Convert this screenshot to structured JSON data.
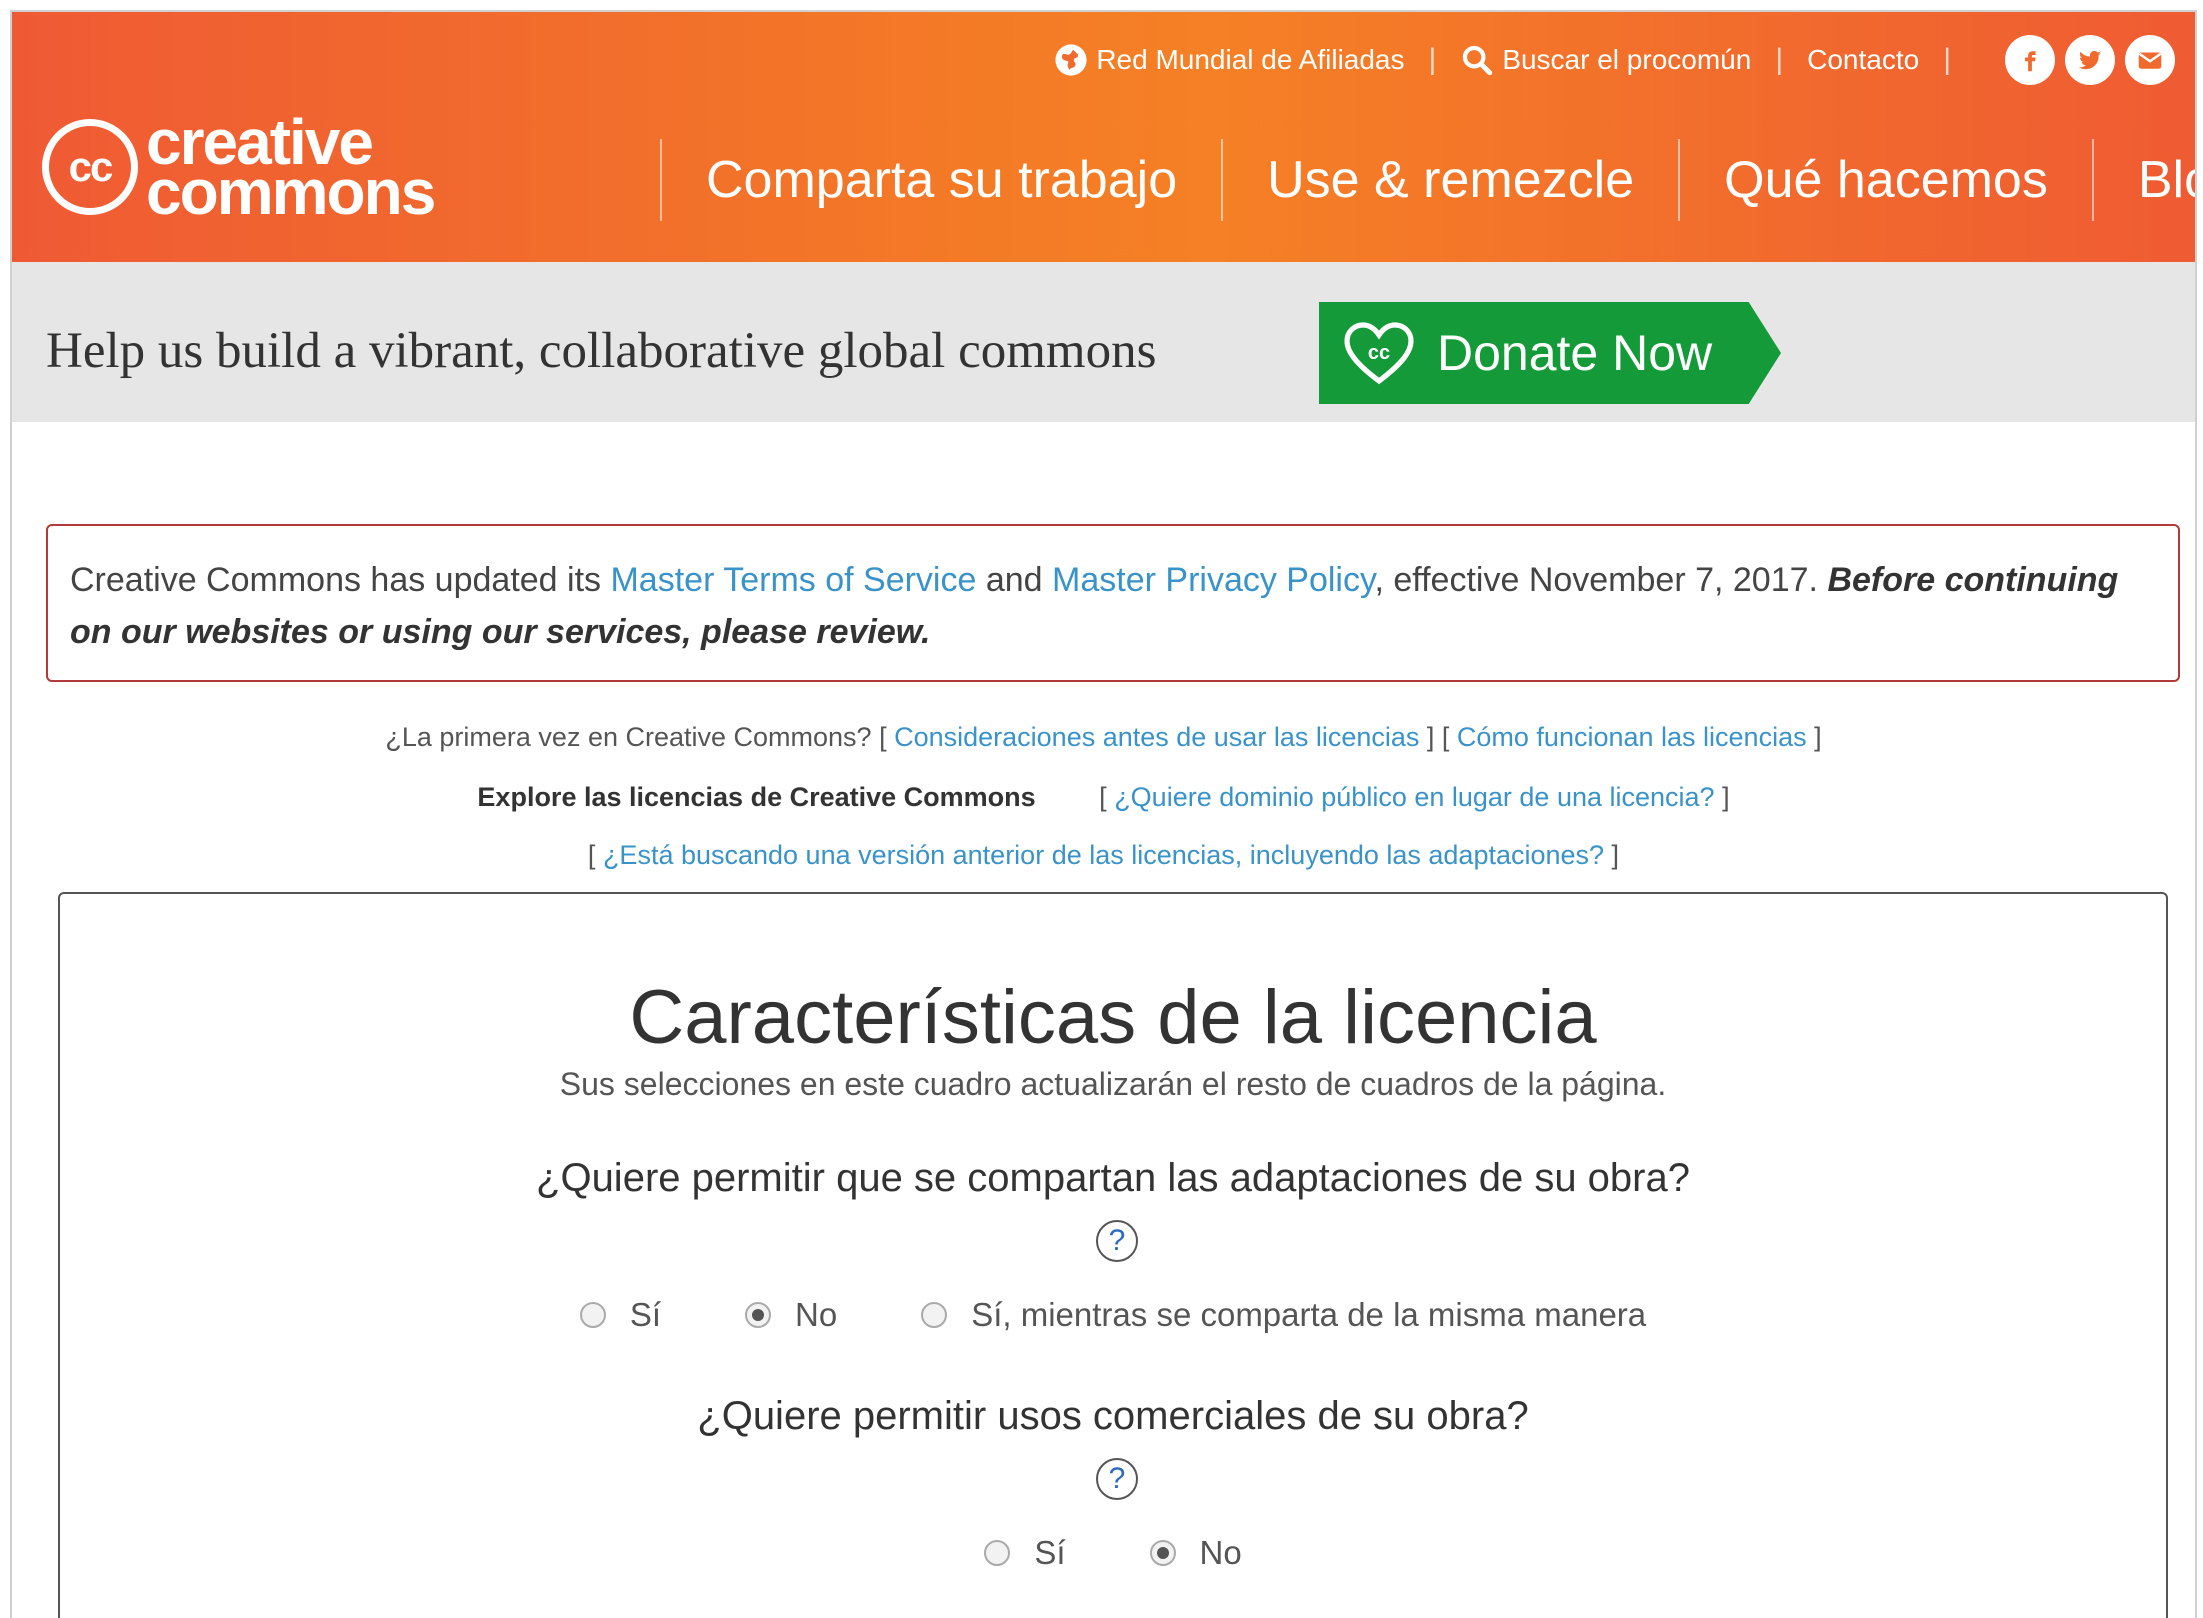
{
  "colors": {
    "header_start": "#ef5a34",
    "header_mid": "#f58025",
    "donate_green": "#159a3a",
    "link_blue": "#3a93c8",
    "notice_border": "#b33a3a",
    "donate_bar_bg": "#e6e6e6"
  },
  "header": {
    "utility": {
      "affiliates": "Red Mundial de Afiliadas",
      "search": "Buscar el procomún",
      "contact": "Contacto",
      "social_icons": [
        "facebook-icon",
        "twitter-icon",
        "email-icon"
      ]
    },
    "logo": {
      "mark": "cc",
      "line1": "creative",
      "line2": "commons"
    },
    "nav": [
      "Comparta su trabajo",
      "Use & remezcle",
      "Qué hacemos",
      "Blog"
    ]
  },
  "donate": {
    "tagline": "Help us build a vibrant, collaborative global commons",
    "button": "Donate Now"
  },
  "notice": {
    "pre": "Creative Commons has updated its ",
    "link1": "Master Terms of Service",
    "mid": " and ",
    "link2": "Master Privacy Policy",
    "post": ", effective November 7, 2017. ",
    "emphasis": "Before continuing on our websites or using our services, please review."
  },
  "intro": {
    "first_time": "¿La primera vez en Creative Commons?",
    "link_considerations": "Consideraciones antes de usar las licencias",
    "link_how": "Cómo funcionan las licencias",
    "explore": "Explore las licencias de Creative Commons",
    "link_public_domain": "¿Quiere dominio público en lugar de una licencia?",
    "link_previous": "¿Está buscando una versión anterior de las licencias, incluyendo las adaptaciones?"
  },
  "license": {
    "title": "Características de la licencia",
    "subtitle": "Sus selecciones en este cuadro actualizarán el resto de cuadros de la página.",
    "q1": {
      "question": "¿Quiere permitir que se compartan las adaptaciones de su obra?",
      "help": "?",
      "options": [
        "Sí",
        "No",
        "Sí, mientras se comparta de la misma manera"
      ],
      "selected": "No"
    },
    "q2": {
      "question": "¿Quiere permitir usos comerciales de su obra?",
      "help": "?",
      "options": [
        "Sí",
        "No"
      ],
      "selected": "No"
    }
  }
}
